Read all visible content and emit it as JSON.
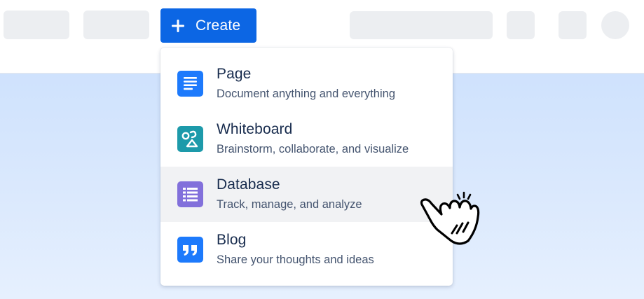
{
  "header": {
    "create_label": "Create"
  },
  "menu": {
    "items": [
      {
        "title": "Page",
        "description": "Document anything and everything",
        "icon": "page-icon",
        "color": "#1d7afc"
      },
      {
        "title": "Whiteboard",
        "description": "Brainstorm, collaborate, and visualize",
        "icon": "whiteboard-icon",
        "color": "#1d9aaa"
      },
      {
        "title": "Database",
        "description": "Track, manage, and analyze",
        "icon": "database-icon",
        "color": "#8270db"
      },
      {
        "title": "Blog",
        "description": "Share your thoughts and ideas",
        "icon": "blog-icon",
        "color": "#1d7afc"
      }
    ]
  },
  "colors": {
    "primary": "#0c66e4",
    "hover_row": "#f1f2f4",
    "title_text": "#172b4d",
    "desc_text": "#44546f"
  }
}
